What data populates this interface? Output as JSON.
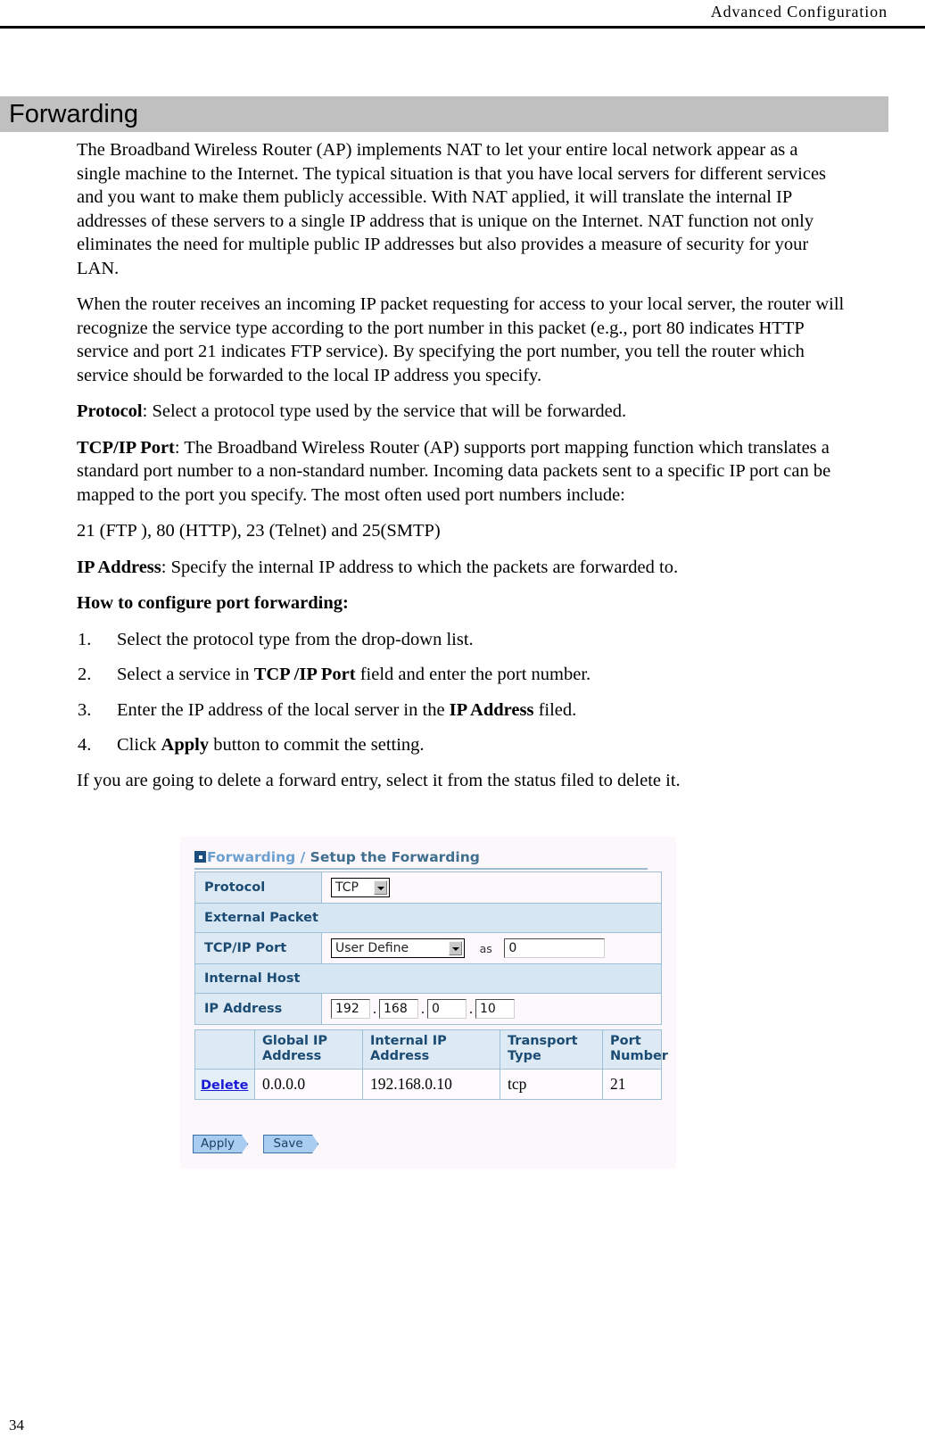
{
  "header": {
    "running_head": "Advanced Configuration"
  },
  "section": {
    "title": "Forwarding"
  },
  "body": {
    "para1": "The Broadband Wireless Router (AP) implements NAT to let your entire local network appear as a single machine to the Internet. The typical situation is that you have local servers for different services and you want to make them publicly accessible. With NAT applied, it will translate the internal IP addresses of these servers to a single IP address that is unique on the Internet. NAT function not only eliminates the need for multiple public IP addresses but also provides a measure of security for your LAN.",
    "para2": "When the router receives an incoming IP packet requesting for access to your local server, the router will recognize the service type according to the port number in this packet (e.g., port 80 indicates HTTP service and port 21 indicates FTP service). By specifying the port number, you tell the router which service should be forwarded to the local IP address you specify.",
    "protocol_term": "Protocol",
    "protocol_def": ": Select a protocol type used by the service that will be forwarded.",
    "tcpip_term": "TCP/IP Port",
    "tcpip_def": ": The Broadband Wireless Router (AP) supports port mapping function which translates a standard port number to a non-standard number. Incoming data packets sent to a specific IP port can be mapped to the port you specify. The most often used port numbers include:",
    "ports_line": "21 (FTP ), 80 (HTTP), 23 (Telnet) and 25(SMTP)",
    "ipaddress_term": "IP Address",
    "ipaddress_def": ": Specify the internal IP address to which the packets are forwarded to.",
    "howto_heading": "How to configure port forwarding:",
    "steps": [
      {
        "num": "1.",
        "pre": "Select the protocol type from the drop-down list.",
        "bold": "",
        "post": ""
      },
      {
        "num": "2.",
        "pre": "Select a service in ",
        "bold": "TCP /IP Port",
        "post": " field and enter the port number."
      },
      {
        "num": "3.",
        "pre": "Enter the IP address of the local server in the ",
        "bold": "IP Address",
        "post": " filed."
      },
      {
        "num": "4.",
        "pre": "Click ",
        "bold": "Apply",
        "post": " button to commit the setting."
      }
    ],
    "closing": "If you are going to delete a forward entry, select it from the status filed to delete it."
  },
  "router_ui": {
    "title_light": "Forwarding / ",
    "title_dark": "Setup the Forwarding",
    "form": {
      "protocol_label": "Protocol",
      "protocol_value": "TCP",
      "external_packet_label": "External Packet",
      "tcpip_port_label": "TCP/IP Port",
      "tcpip_port_value": "User Define",
      "as_label": "as",
      "as_value": "0",
      "internal_host_label": "Internal Host",
      "ip_address_label": "IP Address",
      "ip_octets": [
        "192",
        "168",
        "0",
        "10"
      ],
      "dot": "."
    },
    "results_table": {
      "headers": [
        "",
        "Global IP Address",
        "Internal IP Address",
        "Transport Type",
        "Port Number"
      ],
      "rows": [
        {
          "action": "Delete",
          "global_ip": "0.0.0.0",
          "internal_ip": "192.168.0.10",
          "transport": "tcp",
          "port": "21"
        }
      ]
    },
    "buttons": {
      "apply": "Apply",
      "save": "Save"
    }
  },
  "footer": {
    "page_number": "34"
  },
  "colors": {
    "band": "#c0c0c0",
    "ui_label_bg": "#ddeaf4",
    "ui_section_bg": "#d6e7f3",
    "ui_title_light": "#6b9fd0",
    "ui_title_dark": "#3f6e8e",
    "link": "#1a1ad6",
    "button_face": "#a9cdf0"
  }
}
